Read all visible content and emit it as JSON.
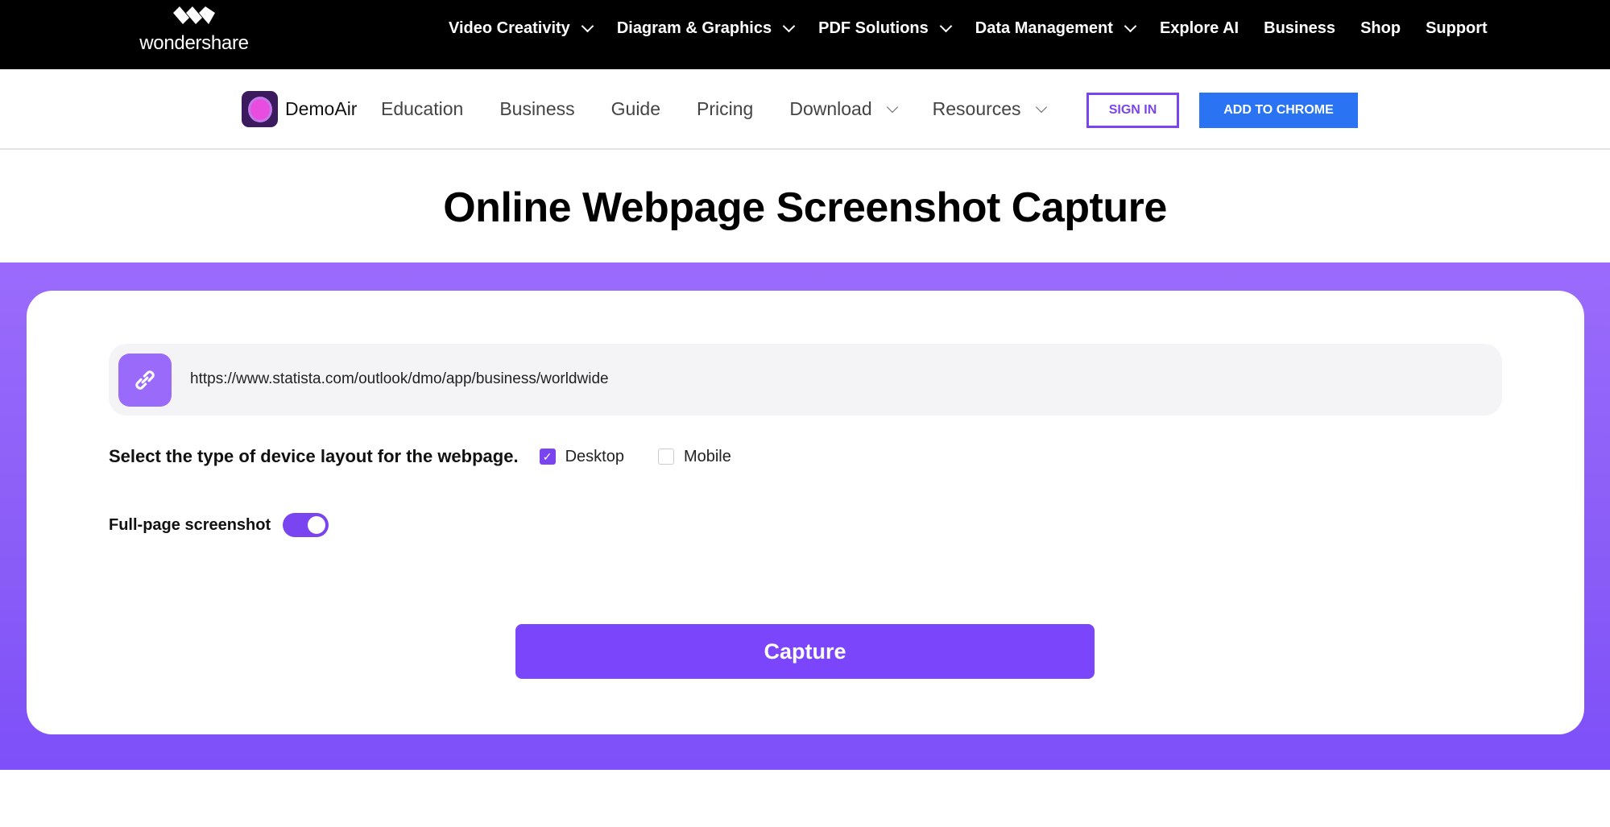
{
  "topbar": {
    "logo_text": "wondershare",
    "items": [
      {
        "label": "Video Creativity",
        "dropdown": true
      },
      {
        "label": "Diagram & Graphics",
        "dropdown": true
      },
      {
        "label": "PDF Solutions",
        "dropdown": true
      },
      {
        "label": "Data Management",
        "dropdown": true
      },
      {
        "label": "Explore AI",
        "dropdown": false
      },
      {
        "label": "Business",
        "dropdown": false
      },
      {
        "label": "Shop",
        "dropdown": false
      },
      {
        "label": "Support",
        "dropdown": false
      }
    ]
  },
  "subnav": {
    "brand": "DemoAir",
    "items": [
      {
        "label": "Education"
      },
      {
        "label": "Business"
      },
      {
        "label": "Guide"
      },
      {
        "label": "Pricing"
      },
      {
        "label": "Download"
      },
      {
        "label": "Resources"
      }
    ],
    "sign_in": "SIGN IN",
    "add_to_chrome": "ADD TO CHROME"
  },
  "page_title": "Online Webpage Screenshot Capture",
  "form": {
    "url_value": "https://www.statista.com/outlook/dmo/app/business/worldwide",
    "device_label": "Select the type of device layout for the webpage.",
    "options": [
      {
        "label": "Desktop",
        "checked": true
      },
      {
        "label": "Mobile",
        "checked": false
      }
    ],
    "fullpage_label": "Full-page screenshot",
    "fullpage_on": true,
    "capture_label": "Capture"
  },
  "colors": {
    "accent": "#7b45fb",
    "chrome_blue": "#2a73f2",
    "band": "#9a6bfb"
  }
}
